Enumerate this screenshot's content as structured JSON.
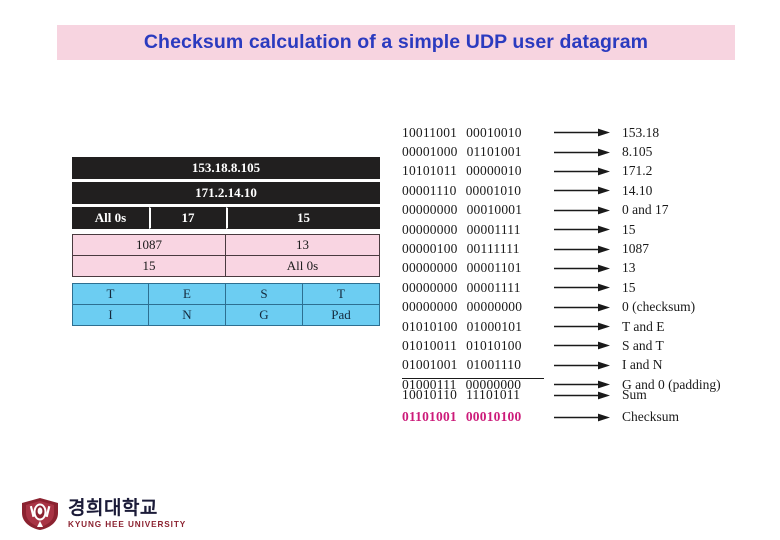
{
  "title": {
    "text": "Checksum calculation of a simple UDP user datagram",
    "banner_color": "#f7d4e0",
    "text_color": "#2b3bbf"
  },
  "datagram": {
    "source_ip_row": {
      "label": "153.18.8.105"
    },
    "dest_ip_row": {
      "label": "171.2.14.10"
    },
    "pseudo_row": [
      {
        "label": "All 0s",
        "width_pct": 25
      },
      {
        "label": "17",
        "width_pct": 25
      },
      {
        "label": "15",
        "width_pct": 50
      }
    ],
    "header_rows": [
      [
        {
          "label": "1087",
          "width_pct": 50
        },
        {
          "label": "13",
          "width_pct": 50
        }
      ],
      [
        {
          "label": "15",
          "width_pct": 50
        },
        {
          "label": "All 0s",
          "width_pct": 50
        }
      ]
    ],
    "data_rows": [
      [
        {
          "label": "T",
          "width_pct": 25
        },
        {
          "label": "E",
          "width_pct": 25
        },
        {
          "label": "S",
          "width_pct": 25
        },
        {
          "label": "T",
          "width_pct": 25
        }
      ],
      [
        {
          "label": "I",
          "width_pct": 25
        },
        {
          "label": "N",
          "width_pct": 25
        },
        {
          "label": "G",
          "width_pct": 25
        },
        {
          "label": "Pad",
          "width_pct": 25
        }
      ]
    ],
    "colors": {
      "black_block": "#211f1f",
      "pink_block": "#f9d5e2",
      "blue_block": "#6ccdf2"
    }
  },
  "calculation": {
    "rows": [
      {
        "left": "10011001",
        "right": "00010010",
        "meaning": "153.18"
      },
      {
        "left": "00001000",
        "right": "01101001",
        "meaning": "8.105"
      },
      {
        "left": "10101011",
        "right": "00000010",
        "meaning": "171.2"
      },
      {
        "left": "00001110",
        "right": "00001010",
        "meaning": "14.10"
      },
      {
        "left": "00000000",
        "right": "00010001",
        "meaning": "0 and 17"
      },
      {
        "left": "00000000",
        "right": "00001111",
        "meaning": "15"
      },
      {
        "left": "00000100",
        "right": "00111111",
        "meaning": "1087"
      },
      {
        "left": "00000000",
        "right": "00001101",
        "meaning": "13"
      },
      {
        "left": "00000000",
        "right": "00001111",
        "meaning": "15"
      },
      {
        "left": "00000000",
        "right": "00000000",
        "meaning": "0 (checksum)"
      },
      {
        "left": "01010100",
        "right": "01000101",
        "meaning": "T and E"
      },
      {
        "left": "01010011",
        "right": "01010100",
        "meaning": "S and T"
      },
      {
        "left": "01001001",
        "right": "01001110",
        "meaning": "I and N"
      },
      {
        "left": "01000111",
        "right": "00000000",
        "meaning": "G and 0 (padding)"
      }
    ],
    "totals": [
      {
        "left": "10010110",
        "right": "11101011",
        "meaning": "Sum",
        "highlight": false
      },
      {
        "left": "01101001",
        "right": "00010100",
        "meaning": "Checksum",
        "highlight": true
      }
    ],
    "checksum_color": "#cc1b7a"
  },
  "footer": {
    "logo_korean": "경희대학교",
    "logo_english": "KYUNG HEE UNIVERSITY",
    "crest_color": "#8b2230"
  }
}
